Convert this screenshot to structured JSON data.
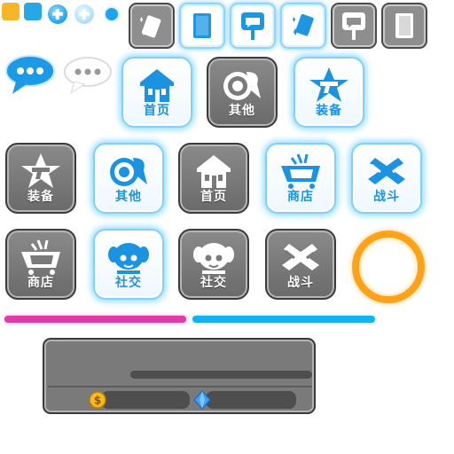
{
  "tiles": [
    {
      "id": "home-top",
      "label": "首页",
      "style": "blue",
      "icon": "house-icon"
    },
    {
      "id": "other-top",
      "label": "其他",
      "style": "gray",
      "icon": "target-icon"
    },
    {
      "id": "equip-top",
      "label": "装备",
      "style": "blue",
      "icon": "star-gun-icon"
    },
    {
      "id": "equip-mid",
      "label": "装备",
      "style": "gray",
      "icon": "star-gun-icon"
    },
    {
      "id": "other-mid",
      "label": "其他",
      "style": "blue",
      "icon": "target-icon"
    },
    {
      "id": "home-mid",
      "label": "首页",
      "style": "gray",
      "icon": "house-icon"
    },
    {
      "id": "shop-mid",
      "label": "商店",
      "style": "blue",
      "icon": "basket-icon"
    },
    {
      "id": "battle-mid",
      "label": "战斗",
      "style": "blue",
      "icon": "crossed-guns-icon"
    },
    {
      "id": "shop-bot",
      "label": "商店",
      "style": "gray",
      "icon": "basket-icon"
    },
    {
      "id": "social-bot-blue",
      "label": "社交",
      "style": "blue",
      "icon": "face-icon"
    },
    {
      "id": "social-bot-gray",
      "label": "社交",
      "style": "gray",
      "icon": "face-icon"
    },
    {
      "id": "battle-bot",
      "label": "战斗",
      "style": "gray",
      "icon": "crossed-guns-icon"
    }
  ],
  "colors": {
    "accent_blue": "#1c93e0",
    "glow_blue": "#8ad9ff",
    "tile_gray": "#7a7a7a",
    "bar_pink": "#e23aa8",
    "bar_cyan": "#12b4ef",
    "ring_orange": "#ffa21a",
    "swatch_yellow": "#f7b52a",
    "swatch_blue": "#27a8e6"
  }
}
